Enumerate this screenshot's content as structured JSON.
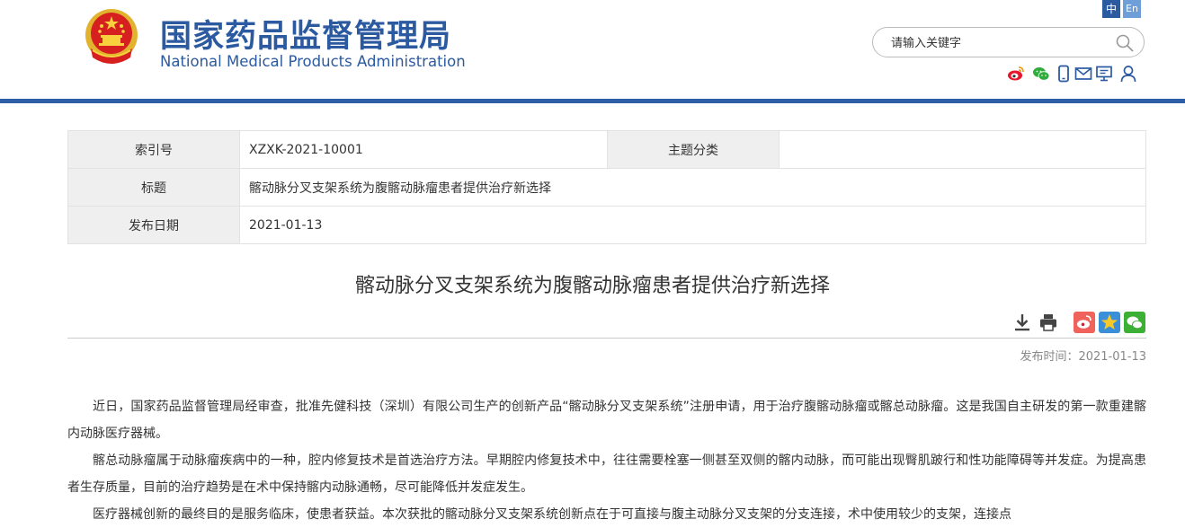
{
  "header": {
    "org_cn": "国家药品监督管理局",
    "org_en": "National Medical Products Administration",
    "lang_zh": "中",
    "lang_en": "En",
    "search_placeholder": "请输入关键字",
    "social_icons": [
      "weibo-icon",
      "wechat-icon",
      "mobile-icon",
      "mail-icon",
      "message-icon",
      "user-icon"
    ],
    "brand_color": "#2b5aa0"
  },
  "meta": {
    "index_label": "索引号",
    "index_value": "XZXK-2021-10001",
    "topic_label": "主题分类",
    "topic_value": "",
    "title_label": "标题",
    "title_value": "髂动脉分叉支架系统为腹髂动脉瘤患者提供治疗新选择",
    "date_label": "发布日期",
    "date_value": "2021-01-13"
  },
  "article": {
    "title": "髂动脉分叉支架系统为腹髂动脉瘤患者提供治疗新选择",
    "publish_time": "发布时间：2021-01-13",
    "paragraphs": [
      "近日，国家药品监督管理局经审查，批准先健科技（深圳）有限公司生产的创新产品“髂动脉分叉支架系统”注册申请，用于治疗腹髂动脉瘤或髂总动脉瘤。这是我国自主研发的第一款重建髂内动脉医疗器械。",
      "髂总动脉瘤属于动脉瘤疾病中的一种，腔内修复技术是首选治疗方法。早期腔内修复技术中，往往需要栓塞一侧甚至双侧的髂内动脉，而可能出现臀肌跛行和性功能障碍等并发症。为提高患者生存质量，目前的治疗趋势是在术中保持髂内动脉通畅，尽可能降低并发症发生。",
      "医疗器械创新的最终目的是服务临床，使患者获益。本次获批的髂动脉分叉支架系统创新点在于可直接与腹主动脉分叉支架的分支连接，术中使用较少的支架，连接点"
    ]
  }
}
